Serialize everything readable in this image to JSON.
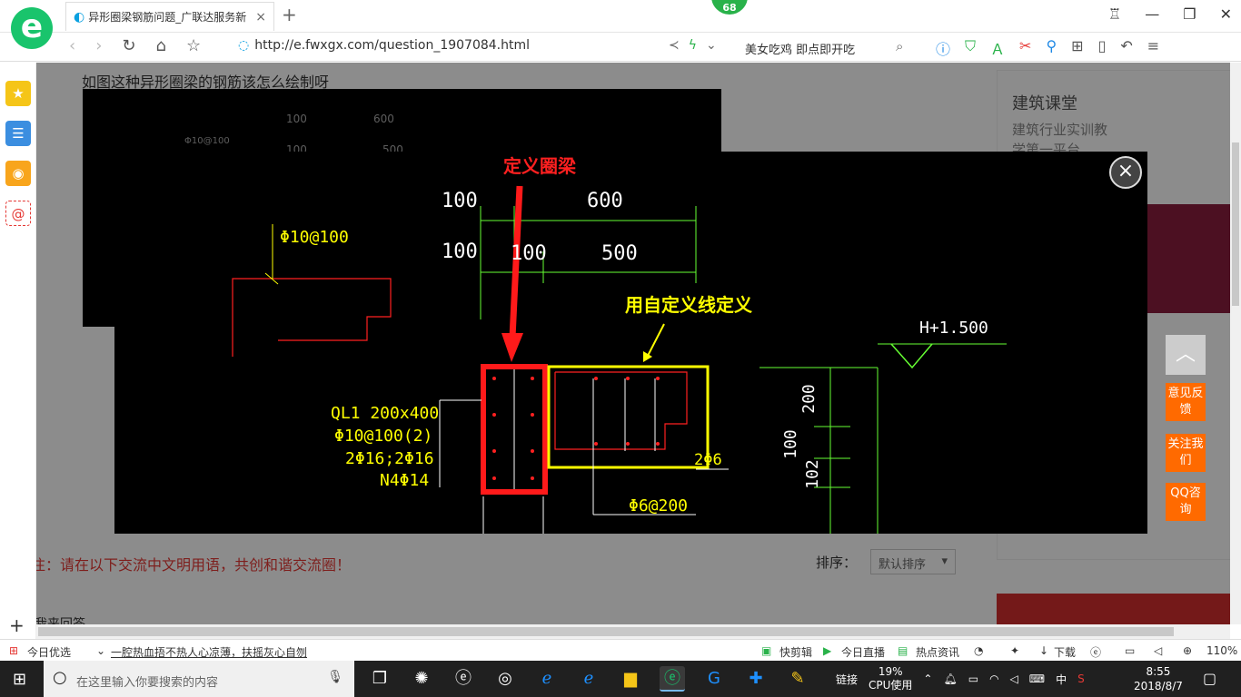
{
  "browser": {
    "tab_title": "异形圈梁钢筋问题_广联达服务新",
    "tab_close": "×",
    "new_tab": "+",
    "badge": "68",
    "url": "http://e.fwxgx.com/question_1907084.html",
    "search_hint": "美女吃鸡 即点即开吃"
  },
  "page": {
    "question_title": "如图这种异形圈梁的钢筋该怎么绘制呀",
    "bg_dims": [
      "100",
      "600",
      "Φ10@100",
      "100",
      "500"
    ],
    "notice": "注：请在以下交流中文明用语，共创和谐交流圈！",
    "sort_label": "排序：",
    "sort_value": "默认排序",
    "my_answer": "我来回答"
  },
  "right_panel": {
    "title": "建筑课堂",
    "subtitle_1": "建筑行业实训教",
    "subtitle_2": "学第一平台"
  },
  "drawing": {
    "annot_red": "定义圈梁",
    "annot_yellow": "用自定义线定义",
    "dim_100_top": "100",
    "dim_600": "600",
    "dim_100_second": "100",
    "dim_100_small": "100",
    "dim_500": "500",
    "rebar_stirrup": "Φ10@100",
    "elevation": "H+1.500",
    "beam_name": "QL1 200x400",
    "beam_stirrup": "Φ10@100(2)",
    "beam_main": "2Φ16;2Φ16",
    "beam_waist": "N4Φ14",
    "bar_2c6": "2Φ6",
    "bar_c6_200": "Φ6@200",
    "vdim_200": "200",
    "vdim_100": "100",
    "vdim_102": "102"
  },
  "modal": {
    "close": "×"
  },
  "float_buttons": {
    "top": "︿",
    "feedback": "意见反馈",
    "follow": "关注我们",
    "qq": "QQ咨询"
  },
  "status_bar": {
    "today_pick": "今日优选",
    "headline": "一腔热血捂不热人心凉薄，扶摇灰心自刎",
    "quick_clip": "快剪辑",
    "live": "今日直播",
    "news": "热点资讯",
    "download": "下载",
    "zoom": "110%"
  },
  "taskbar": {
    "search_placeholder": "在这里输入你要搜索的内容",
    "link": "链接",
    "cpu_percent": "19%",
    "cpu_label": "CPU使用",
    "ime": "中",
    "time": "8:55",
    "date": "2018/8/7"
  },
  "colors": {
    "cad_yellow": "#ffff00",
    "cad_green": "#66ff33",
    "cad_red": "#ff2020",
    "cad_white": "#ffffff",
    "accent_orange": "#ff6a00",
    "brand_green": "#19c46c"
  }
}
